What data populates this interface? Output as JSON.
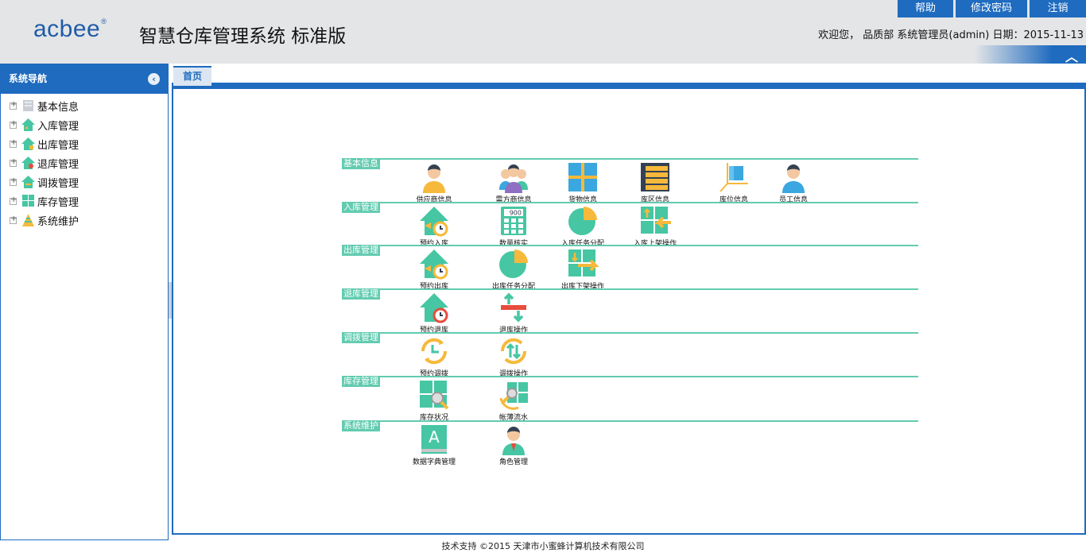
{
  "header": {
    "logo": "acbee",
    "logo_mark": "®",
    "title": "智慧仓库管理系统 标准版",
    "buttons": {
      "help": "帮助",
      "change_password": "修改密码",
      "logout": "注销"
    },
    "welcome": "欢迎您， 品质部 系统管理员(admin) 日期：2015-11-13"
  },
  "sidebar": {
    "title": "系统导航",
    "items": [
      {
        "label": "基本信息",
        "icon": "basic-info-icon"
      },
      {
        "label": "入库管理",
        "icon": "inbound-icon"
      },
      {
        "label": "出库管理",
        "icon": "outbound-icon"
      },
      {
        "label": "退库管理",
        "icon": "return-icon"
      },
      {
        "label": "调拨管理",
        "icon": "transfer-icon"
      },
      {
        "label": "库存管理",
        "icon": "inventory-icon"
      },
      {
        "label": "系统维护",
        "icon": "maintenance-icon"
      }
    ]
  },
  "tabs": [
    {
      "label": "首页"
    }
  ],
  "sections": [
    {
      "label": "基本信息",
      "items": [
        {
          "label": "供应商信息",
          "icon": "person-icon"
        },
        {
          "label": "需方商信息",
          "icon": "group-icon"
        },
        {
          "label": "货物信息",
          "icon": "grid-icon"
        },
        {
          "label": "库区信息",
          "icon": "list-icon"
        },
        {
          "label": "库位信息",
          "icon": "location-icon"
        },
        {
          "label": "员工信息",
          "icon": "employee-icon"
        }
      ]
    },
    {
      "label": "入库管理",
      "items": [
        {
          "label": "预约入库",
          "icon": "house-clock-icon"
        },
        {
          "label": "数量核实",
          "icon": "calculator-icon"
        },
        {
          "label": "入库任务分配",
          "icon": "pie-icon"
        },
        {
          "label": "入库上架操作",
          "icon": "shelf-in-icon"
        }
      ]
    },
    {
      "label": "出库管理",
      "items": [
        {
          "label": "预约出库",
          "icon": "house-clock-icon"
        },
        {
          "label": "出库任务分配",
          "icon": "pie-icon"
        },
        {
          "label": "出库下架操作",
          "icon": "shelf-out-icon"
        }
      ]
    },
    {
      "label": "退库管理",
      "items": [
        {
          "label": "预约退库",
          "icon": "house-clock-red-icon"
        },
        {
          "label": "退库操作",
          "icon": "return-arrows-icon"
        }
      ]
    },
    {
      "label": "调拨管理",
      "items": [
        {
          "label": "预约调拨",
          "icon": "clock-refresh-icon"
        },
        {
          "label": "调拨操作",
          "icon": "swap-refresh-icon"
        }
      ]
    },
    {
      "label": "库存管理",
      "items": [
        {
          "label": "库存状况",
          "icon": "grid-search-icon"
        },
        {
          "label": "帐薄流水",
          "icon": "ledger-flow-icon"
        }
      ]
    },
    {
      "label": "系统维护",
      "items": [
        {
          "label": "数据字典管理",
          "icon": "dictionary-icon"
        },
        {
          "label": "角色管理",
          "icon": "role-icon"
        }
      ]
    }
  ],
  "footer": "技术支持 ©2015 天津市小蜜蜂计算机技术有限公司",
  "colors": {
    "primary": "#1e6bbf",
    "section": "#62cbb0",
    "header_bg": "#e4e5e7"
  }
}
